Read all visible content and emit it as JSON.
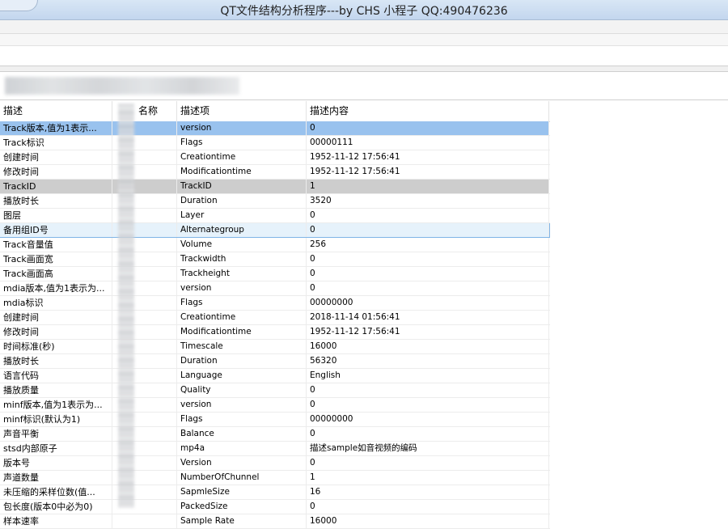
{
  "window": {
    "title": "QT文件结构分析程序---by CHS 小程子 QQ:490476236"
  },
  "table": {
    "headers": [
      "描述",
      "名称",
      "描述项",
      "描述内容"
    ],
    "rows": [
      [
        "Track版本,值为1表示...",
        "",
        "version",
        "0"
      ],
      [
        "Track标识",
        "",
        "Flags",
        "00000111"
      ],
      [
        "创建时间",
        "",
        "Creationtime",
        "1952-11-12 17:56:41"
      ],
      [
        "修改时间",
        "",
        "Modificationtime",
        "1952-11-12 17:56:41"
      ],
      [
        "TrackID",
        "",
        "TrackID",
        "1"
      ],
      [
        "播放时长",
        "",
        "Duration",
        "3520"
      ],
      [
        "图层",
        "",
        "Layer",
        "0"
      ],
      [
        "备用组ID号",
        "",
        "Alternategroup",
        "0"
      ],
      [
        "Track音量值",
        "",
        "Volume",
        "256"
      ],
      [
        "Track画面宽",
        "",
        "Trackwidth",
        "0"
      ],
      [
        "Track画面高",
        "",
        "Trackheight",
        "0"
      ],
      [
        "mdia版本,值为1表示为...",
        "",
        "version",
        "0"
      ],
      [
        "mdia标识",
        "",
        "Flags",
        "00000000"
      ],
      [
        "创建时间",
        "",
        "Creationtime",
        "2018-11-14 01:56:41"
      ],
      [
        "修改时间",
        "",
        "Modificationtime",
        "1952-11-12 17:56:41"
      ],
      [
        "时间标准(秒)",
        "",
        "Timescale",
        "16000"
      ],
      [
        "播放时长",
        "",
        "Duration",
        "56320"
      ],
      [
        "语言代码",
        "",
        "Language",
        "English"
      ],
      [
        "播放质量",
        "",
        "Quality",
        "0"
      ],
      [
        "minf版本,值为1表示为...",
        "",
        "version",
        "0"
      ],
      [
        "minf标识(默认为1)",
        "",
        "Flags",
        "00000000"
      ],
      [
        "声音平衡",
        "",
        "Balance",
        "0"
      ],
      [
        "stsd内部原子",
        "",
        "mp4a",
        "描述sample如音视频的编码"
      ],
      [
        "版本号",
        "",
        "Version",
        "0"
      ],
      [
        "声道数量",
        "",
        "NumberOfChunnel",
        "1"
      ],
      [
        "未压缩的采样位数(值...",
        "",
        "SapmleSize",
        "16"
      ],
      [
        "包长度(版本0中必为0)",
        "",
        "PackedSize",
        "0"
      ],
      [
        "样本速率",
        "",
        "Sample Rate",
        "16000"
      ]
    ],
    "selected_row": 0,
    "highlighted_row": 4,
    "focused_row": 7
  },
  "colors": {
    "selection": "#99c2ee",
    "inactive_selection": "#cdcdcd",
    "titlebar": "#c3d6ee"
  }
}
